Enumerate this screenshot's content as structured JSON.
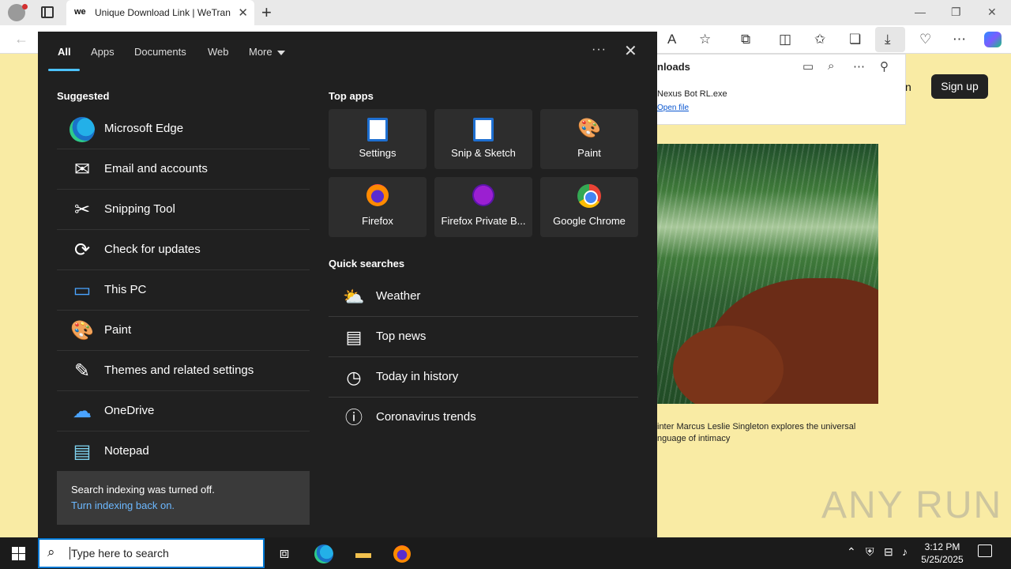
{
  "browser": {
    "tab_title": "Unique Download Link | WeTrans",
    "tab_favicon": "we",
    "window_controls": [
      "—",
      "❐",
      "✕"
    ]
  },
  "downloads": {
    "title": "nloads",
    "file_name": "Nexus Bot RL.exe",
    "open_link": "Open file"
  },
  "page": {
    "partial_link": "n",
    "signup": "Sign up",
    "caption": "inter Marcus Leslie Singleton explores the universal nguage of intimacy",
    "watermark": "ANY RUN"
  },
  "search_panel": {
    "tabs": [
      {
        "label": "All"
      },
      {
        "label": "Apps"
      },
      {
        "label": "Documents"
      },
      {
        "label": "Web"
      },
      {
        "label": "More"
      }
    ],
    "suggested_title": "Suggested",
    "suggested": [
      {
        "label": "Microsoft Edge",
        "icon": "edge-icon"
      },
      {
        "label": "Email and accounts",
        "icon": "mail-icon"
      },
      {
        "label": "Snipping Tool",
        "icon": "scissors-icon"
      },
      {
        "label": "Check for updates",
        "icon": "refresh-icon"
      },
      {
        "label": "This PC",
        "icon": "computer-icon"
      },
      {
        "label": "Paint",
        "icon": "palette-icon"
      },
      {
        "label": "Themes and related settings",
        "icon": "brush-icon"
      },
      {
        "label": "OneDrive",
        "icon": "cloud-icon"
      },
      {
        "label": "Notepad",
        "icon": "notepad-icon"
      }
    ],
    "index_notice": {
      "text": "Search indexing was turned off.",
      "link": "Turn indexing back on."
    },
    "top_apps_title": "Top apps",
    "top_apps": [
      {
        "label": "Settings",
        "icon": "settings-doc-icon"
      },
      {
        "label": "Snip & Sketch",
        "icon": "snip-doc-icon"
      },
      {
        "label": "Paint",
        "icon": "palette-icon"
      },
      {
        "label": "Firefox",
        "icon": "firefox-icon"
      },
      {
        "label": "Firefox Private B...",
        "icon": "firefox-private-icon"
      },
      {
        "label": "Google Chrome",
        "icon": "chrome-icon"
      }
    ],
    "quick_searches_title": "Quick searches",
    "quick_searches": [
      {
        "label": "Weather",
        "icon": "weather-icon"
      },
      {
        "label": "Top news",
        "icon": "news-icon"
      },
      {
        "label": "Today in history",
        "icon": "clock-icon"
      },
      {
        "label": "Coronavirus trends",
        "icon": "info-icon"
      }
    ]
  },
  "taskbar": {
    "search_placeholder": "Type here to search",
    "time": "3:12 PM",
    "date": "5/25/2025"
  },
  "colors": {
    "accent": "#4cc2ff",
    "panel_bg": "#202020",
    "page_bg": "#f9eba4"
  }
}
